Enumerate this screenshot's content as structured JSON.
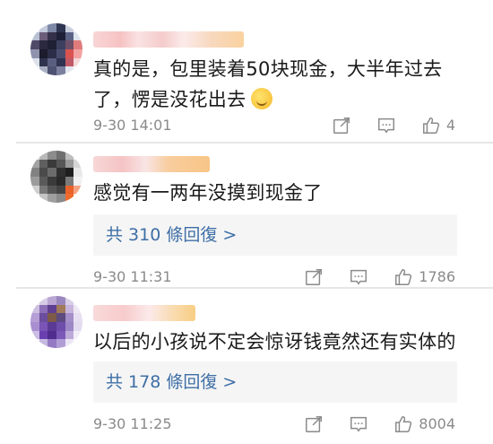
{
  "comments": [
    {
      "text_line1": "真的是，包里装着50块现金，大半年过去",
      "text_line2": "了，愣是没花出去",
      "time": "9-30 14:01",
      "likes": "4",
      "emoji": "smile-emoji"
    },
    {
      "text_line1": "感觉有一两年没摸到现金了",
      "replies": "共 310 條回復 >",
      "time": "9-30 11:31",
      "likes": "1786"
    },
    {
      "text_line1": "以后的小孩说不定会惊讶钱竟然还有实体的",
      "replies": "共 178 條回復 >",
      "time": "9-30 11:25",
      "likes": "8004"
    }
  ],
  "icons": {
    "share": "share-icon",
    "comment": "comment-icon",
    "like": "like-icon"
  }
}
